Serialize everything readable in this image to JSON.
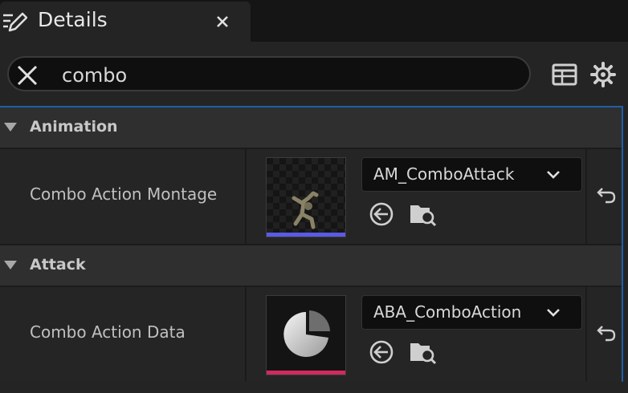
{
  "tab": {
    "title": "Details",
    "icon": "edit-list-icon",
    "close_icon": "close-icon"
  },
  "search": {
    "value": "combo",
    "clear_icon": "clear-x-icon"
  },
  "toolbar": {
    "table_icon": "property-matrix-icon",
    "settings_icon": "gear-icon"
  },
  "categories": [
    {
      "label": "Animation",
      "properties": [
        {
          "label": "Combo Action Montage",
          "asset": "AM_ComboAttack",
          "thumbnail": "animation-montage-thumbnail",
          "type_color": "#5a5ae6"
        }
      ]
    },
    {
      "label": "Attack",
      "properties": [
        {
          "label": "Combo Action Data",
          "asset": "ABA_ComboAction",
          "thumbnail": "data-asset-pie-thumbnail",
          "type_color": "#d02a5e"
        }
      ]
    }
  ],
  "accent": "#1f5fa8"
}
